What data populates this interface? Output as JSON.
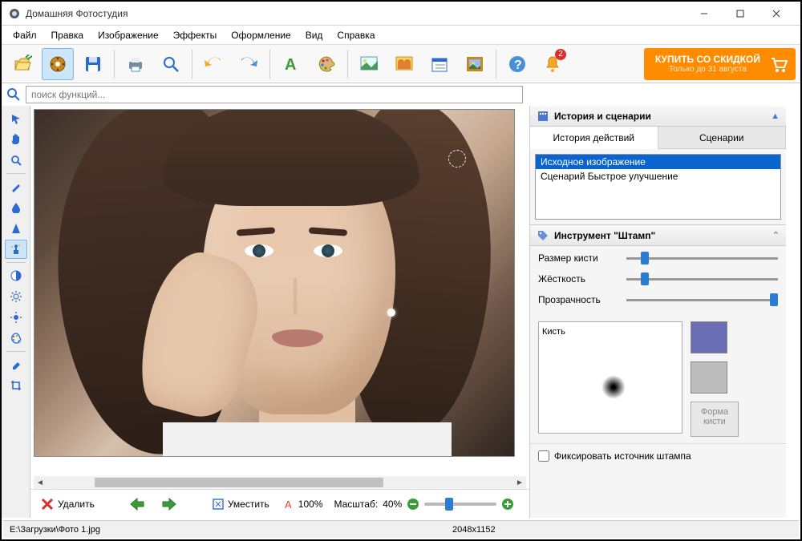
{
  "title": "Домашняя Фотостудия",
  "menu": [
    "Файл",
    "Правка",
    "Изображение",
    "Эффекты",
    "Оформление",
    "Вид",
    "Справка"
  ],
  "promo": {
    "line1": "КУПИТЬ СО СКИДКОЙ",
    "line2": "Только до 31 августа"
  },
  "search": {
    "placeholder": "поиск функций..."
  },
  "right": {
    "history_title": "История и сценарии",
    "tabs": {
      "history": "История действий",
      "scenarios": "Сценарии"
    },
    "history_items": [
      "Исходное изображение",
      "Сценарий Быстрое улучшение"
    ],
    "tool_title": "Инструмент \"Штамп\"",
    "sliders": {
      "brush_size": "Размер кисти",
      "hardness": "Жёсткость",
      "opacity": "Прозрачность"
    },
    "brush_label": "Кисть",
    "shape_btn": "Форма\nкисти",
    "checkbox": "Фиксировать источник штампа",
    "colors": {
      "primary": "#6a6fb5",
      "secondary": "#bcbcbc"
    }
  },
  "footer": {
    "delete": "Удалить",
    "fit": "Уместить",
    "percent": "100%",
    "scale_label": "Масштаб:",
    "scale_value": "40%"
  },
  "status": {
    "path": "E:\\Загрузки\\Фото 1.jpg",
    "dims": "2048x1152"
  },
  "notif_badge": "2"
}
